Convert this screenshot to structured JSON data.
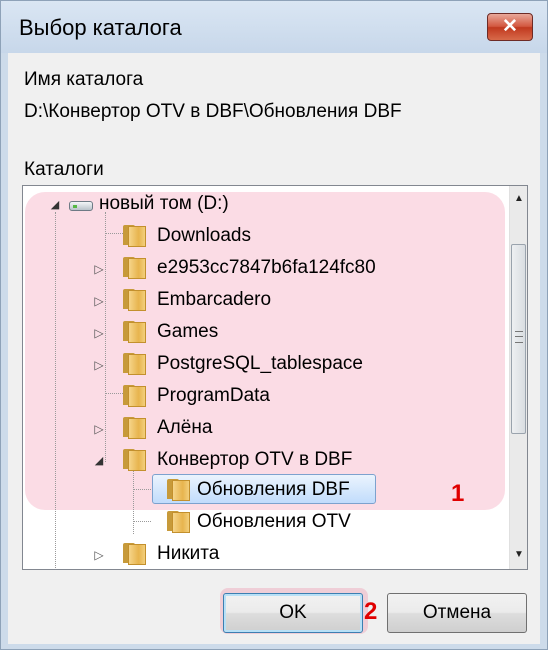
{
  "window": {
    "title": "Выбор каталога",
    "close_glyph": "✕"
  },
  "folder_name_label": "Имя каталога",
  "current_path": "D:\\Конвертор OTV в DBF\\Обновления DBF",
  "folders_label": "Каталоги",
  "tree": {
    "root": "новый том (D:)",
    "items": [
      {
        "label": "Downloads"
      },
      {
        "label": "e2953cc7847b6fa124fc80"
      },
      {
        "label": "Embarcadero"
      },
      {
        "label": "Games"
      },
      {
        "label": "PostgreSQL_tablespace"
      },
      {
        "label": "ProgramData"
      },
      {
        "label": "Алёна"
      },
      {
        "label": "Конвертор OTV в DBF"
      },
      {
        "label": "Обновления DBF"
      },
      {
        "label": "Обновления OTV"
      },
      {
        "label": "Никита"
      }
    ]
  },
  "annotations": {
    "mark1": "1",
    "mark2": "2"
  },
  "buttons": {
    "ok": "OK",
    "cancel": "Отмена"
  },
  "colors": {
    "highlight": "#ef82a0",
    "annotation": "#e00000",
    "selection": "#c1dcfc"
  }
}
